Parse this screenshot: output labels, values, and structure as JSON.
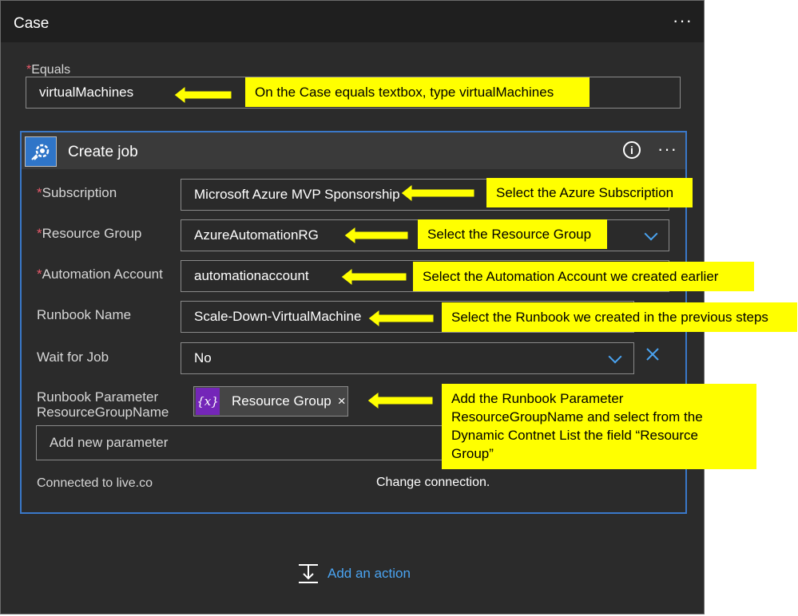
{
  "case": {
    "title": "Case",
    "menu": "···",
    "equals_label": "Equals",
    "equals_value": "virtualMachines"
  },
  "card": {
    "title": "Create job",
    "info": "i",
    "menu": "···",
    "icon": "automation-job-icon",
    "fields": {
      "subscription": {
        "label": "Subscription",
        "value": "Microsoft Azure  MVP Sponsorship"
      },
      "resource_group": {
        "label": "Resource Group",
        "value": "AzureAutomationRG"
      },
      "automation_account": {
        "label": "Automation Account",
        "value": "automationaccount"
      },
      "runbook_name": {
        "label": "Runbook Name",
        "value": "Scale-Down-VirtualMachine"
      },
      "wait_for_job": {
        "label": "Wait for Job",
        "value": "No"
      },
      "runbook_parameter": {
        "label_line1": "Runbook Parameter",
        "label_line2": "ResourceGroupName",
        "token_fx": "{x}",
        "token_label": "Resource Group",
        "token_remove": "×"
      }
    },
    "add_parameter_placeholder": "Add new parameter",
    "connected_to": "Connected to live.co",
    "change_connection": "Change connection."
  },
  "add_action": {
    "label": "Add an action"
  },
  "callouts": {
    "equals": "On the Case equals textbox, type virtualMachines",
    "subscription": "Select the Azure Subscription",
    "resource_group": "Select the Resource Group",
    "automation_account": "Select the Automation Account we created earlier",
    "runbook": "Select the Runbook we created in the previous steps",
    "parameter_lines": [
      "Add the Runbook Parameter",
      "ResourceGroupName and select from the",
      "Dynamic Contnet List the field “Resource",
      "Group”"
    ]
  },
  "colors": {
    "accent": "#3a78c9",
    "callout": "#ffff00",
    "required": "#e8596a",
    "link": "#4aa3f0",
    "token": "#7426b8"
  }
}
